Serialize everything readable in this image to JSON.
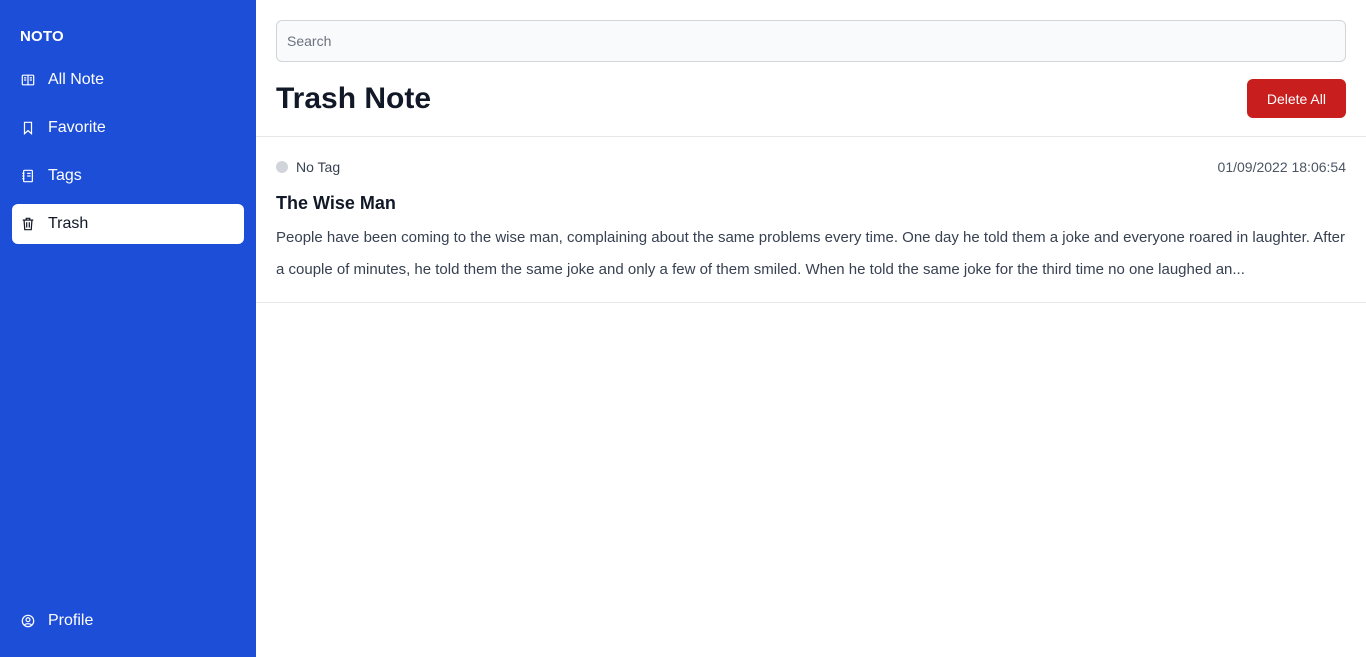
{
  "app": {
    "brand": "NOTO"
  },
  "sidebar": {
    "items": [
      {
        "label": "All Note",
        "icon": "book-open-icon"
      },
      {
        "label": "Favorite",
        "icon": "bookmark-icon"
      },
      {
        "label": "Tags",
        "icon": "address-book-icon"
      },
      {
        "label": "Trash",
        "icon": "trash-icon",
        "active": true
      }
    ],
    "profile": {
      "label": "Profile",
      "icon": "user-circle-icon"
    }
  },
  "search": {
    "placeholder": "Search",
    "value": ""
  },
  "main": {
    "title": "Trash Note",
    "delete_all_label": "Delete All"
  },
  "notes": [
    {
      "tag": "No Tag",
      "tag_color": "#d1d5db",
      "date": "01/09/2022 18:06:54",
      "title": "The Wise Man",
      "body": "People have been coming to the wise man, complaining about the same problems every time. One day he told them a joke and everyone roared in laughter. After a couple of minutes, he told them the same joke and only a few of them smiled. When he told the same joke for the third time no one laughed an..."
    }
  ],
  "colors": {
    "sidebar_bg": "#1d4ed8",
    "danger": "#c81e1e"
  }
}
